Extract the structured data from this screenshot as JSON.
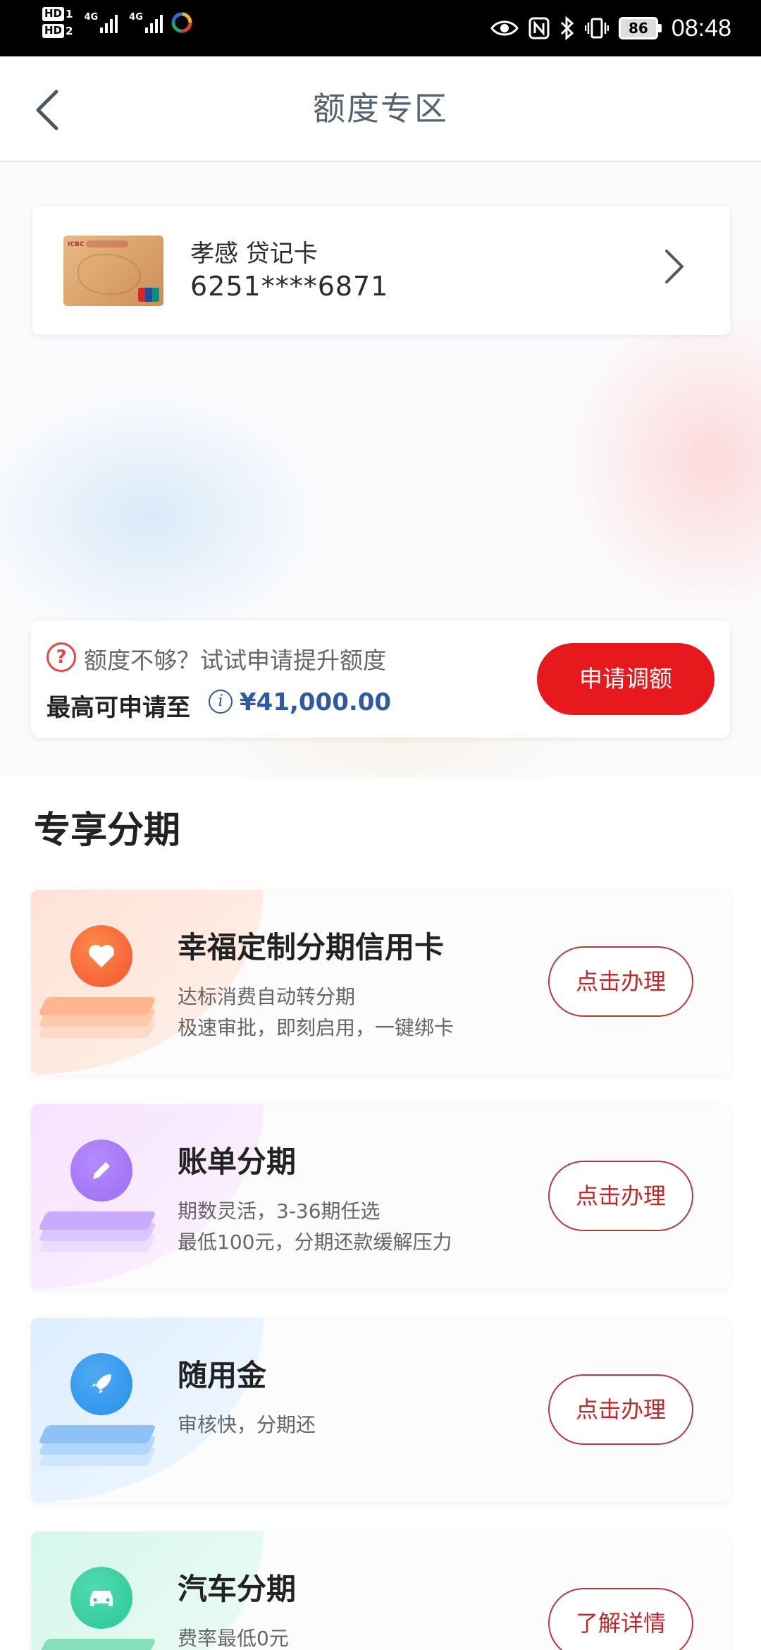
{
  "status_bar": {
    "sim1": "HD",
    "sim1_num": "1",
    "sim2": "HD",
    "sim2_num": "2",
    "network1": "4G",
    "network2": "4G",
    "battery": "86",
    "time": "08:48",
    "icons": [
      "eye-icon",
      "nfc-icon",
      "bluetooth-icon",
      "vibrate-icon"
    ]
  },
  "nav": {
    "back_icon": "chevron-left-icon",
    "title": "额度专区"
  },
  "card": {
    "name": "孝感 贷记卡",
    "number": "6251****6871",
    "card_logo": "ICBC",
    "arrow_icon": "chevron-right-icon"
  },
  "limit": {
    "hint": "额度不够？试试申请提升额度",
    "label": "最高可申请至",
    "amount": "¥41,000.00",
    "button": "申请调额"
  },
  "section": {
    "title": "专享分期"
  },
  "services": [
    {
      "title": "幸福定制分期信用卡",
      "desc1": "达标消费自动转分期",
      "desc2": "极速审批，即刻启用，一键绑卡",
      "button": "点击办理",
      "icon": "heart-icon",
      "color": "#f2542d"
    },
    {
      "title": "账单分期",
      "desc1": "期数灵活，3-36期任选",
      "desc2": "最低100元，分期还款缓解压力",
      "button": "点击办理",
      "icon": "pencil-icon",
      "color": "#9b6cf0"
    },
    {
      "title": "随用金",
      "desc1": "审核快，分期还",
      "desc2": "",
      "button": "点击办理",
      "icon": "rocket-icon",
      "color": "#2a8fe8"
    },
    {
      "title": "汽车分期",
      "desc1": "费率最低0元",
      "desc2": "",
      "button": "了解详情",
      "icon": "car-icon",
      "color": "#2cc69a"
    }
  ]
}
